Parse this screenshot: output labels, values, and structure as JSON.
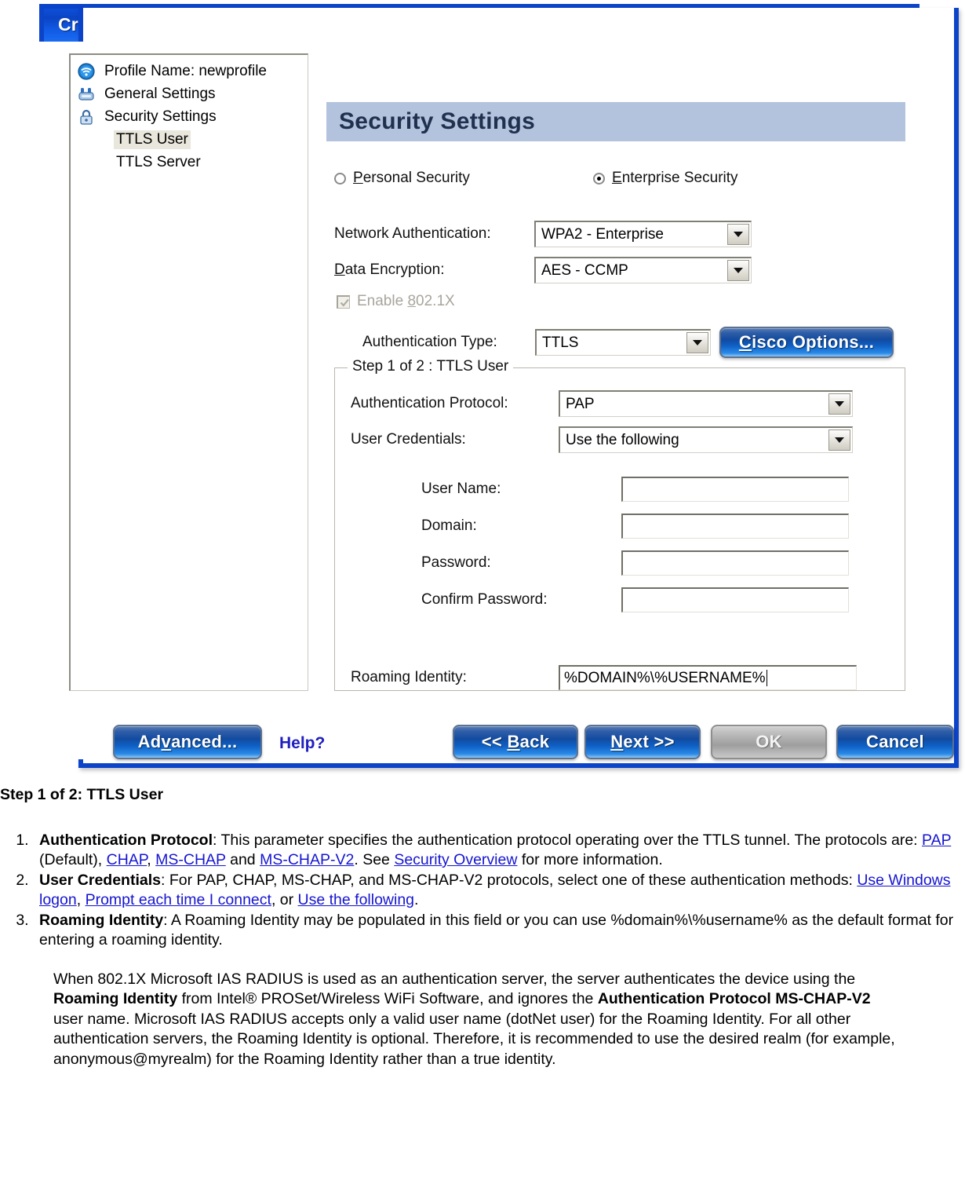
{
  "window": {
    "title": "Create WiFi Profile",
    "close_icon": "close-icon"
  },
  "tree": {
    "items": [
      {
        "label": "Profile Name: newprofile",
        "icon": "wifi-signal-icon",
        "indent": false,
        "selected": false
      },
      {
        "label": "General Settings",
        "icon": "general-settings-icon",
        "indent": false,
        "selected": false
      },
      {
        "label": "Security Settings",
        "icon": "padlock-icon",
        "indent": false,
        "selected": false
      },
      {
        "label": "TTLS User",
        "icon": "",
        "indent": true,
        "selected": true
      },
      {
        "label": "TTLS Server",
        "icon": "",
        "indent": true,
        "selected": false
      }
    ]
  },
  "panel": {
    "header": "Security Settings",
    "security_mode": {
      "personal_label": "Personal Security",
      "personal_accel": "P",
      "personal_selected": false,
      "enterprise_label": "Enterprise Security",
      "enterprise_accel": "E",
      "enterprise_selected": true
    },
    "network_authentication": {
      "label": "Network Authentication:",
      "value": "WPA2 - Enterprise"
    },
    "data_encryption": {
      "label": "Data Encryption:",
      "label_accel": "D",
      "value": "AES - CCMP"
    },
    "enable_8021x": {
      "label": "Enable 802.1X",
      "checked": true,
      "disabled": true
    },
    "authentication_type": {
      "label": "Authentication Type:",
      "value": "TTLS"
    },
    "cisco_options_button": "Cisco Options..."
  },
  "group": {
    "legend": "Step 1 of 2 : TTLS User",
    "authentication_protocol": {
      "label": "Authentication Protocol:",
      "value": "PAP"
    },
    "user_credentials": {
      "label": "User Credentials:",
      "value": "Use the following"
    },
    "user_name": {
      "label": "User Name:",
      "value": ""
    },
    "domain": {
      "label": "Domain:",
      "value": ""
    },
    "password": {
      "label": "Password:",
      "value": ""
    },
    "confirm_password": {
      "label": "Confirm Password:",
      "value": ""
    },
    "roaming_identity": {
      "label": "Roaming Identity:",
      "value": "%DOMAIN%\\%USERNAME%"
    }
  },
  "buttons": {
    "advanced": "Advanced...",
    "help": "Help?",
    "back": "<< Back",
    "next": "Next >>",
    "ok": "OK",
    "cancel": "Cancel",
    "ok_disabled": true
  },
  "doc": {
    "heading": "Step 1 of 2: TTLS User",
    "item1": {
      "term": "Authentication Protocol",
      "t1": ": This parameter specifies the authentication protocol operating over the TTLS tunnel. The protocols are: ",
      "l1": "PAP",
      "t2": " (Default), ",
      "l2": "CHAP",
      "t3": ", ",
      "l3": "MS-CHAP",
      "t4": " and ",
      "l4": "MS-CHAP-V2",
      "t5": ". See ",
      "l5": "Security Overview",
      "t6": " for more information."
    },
    "item2": {
      "term": "User Credentials",
      "t1": ": For PAP, CHAP, MS-CHAP, and MS-CHAP-V2 protocols, select one of these authentication methods: ",
      "l1": "Use Windows logon",
      "t2": ", ",
      "l2": "Prompt each time I connect",
      "t3": ", or ",
      "l3": "Use the following",
      "t4": "."
    },
    "item3": {
      "term": "Roaming Identity",
      "t1": ": A Roaming Identity may be populated in this field or you can use %domain%\\%username% as the default format for entering a roaming identity."
    },
    "note": {
      "p1": "When 802.1X Microsoft IAS RADIUS is used as an authentication server, the server authenticates the device using the ",
      "b1": "Roaming Identity",
      "p2": " from Intel® PROSet/Wireless WiFi Software, and ignores the ",
      "b2": "Authentication Protocol MS-CHAP-V2",
      "p3": " user name. Microsoft IAS RADIUS accepts only a valid user name (dotNet user) for the Roaming Identity. For all other authentication servers, the Roaming Identity is optional. Therefore, it is recommended to use the desired realm (for example, anonymous@myrealm) for the Roaming Identity rather than a true identity."
    }
  }
}
